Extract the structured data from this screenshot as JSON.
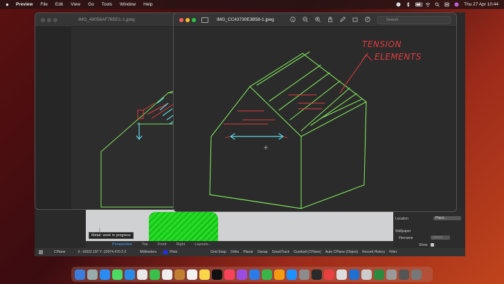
{
  "menubar": {
    "app": "Preview",
    "items": [
      "File",
      "Edit",
      "View",
      "Go",
      "Tools",
      "Window",
      "Help"
    ],
    "datetime": "Thu 27 Apr  10:44"
  },
  "back_window": {
    "title": "IMG_48056AF76EE1-1.jpeg"
  },
  "front_window": {
    "title": "IMG_CC43730E3B58-1.jpeg",
    "search_placeholder": "Search",
    "annotation_line1": "TENSION",
    "annotation_line2": "ELEMENTS"
  },
  "rhino": {
    "command_tip": "Metal: work in progress",
    "viewport_tabs": [
      "Perspective",
      "Top",
      "Front",
      "Right",
      "Layouts..."
    ],
    "active_tab": "Perspective",
    "status": {
      "cplane": "CPlane",
      "coords": "X -16022.197  Y -22674.470  Z 0",
      "units": "Millimeters",
      "layer": "Plots",
      "toggles": [
        "Grid Snap",
        "Ortho",
        "Planar",
        "Osnap",
        "SmartTrack",
        "Gumball (CPlane)",
        "Auto CPlane (Object)",
        "Record History",
        "Filter"
      ]
    },
    "panel": {
      "location_label": "Location",
      "location_button": "Place...",
      "wallpaper_label": "Wallpaper",
      "filename_label": "Filename",
      "filename_value": "(none)",
      "show_label": "Show"
    }
  },
  "colors": {
    "drawing_green": "#7fe35a",
    "annotation_red": "#e23c3c",
    "arrow_cyan": "#5ed8e8"
  }
}
